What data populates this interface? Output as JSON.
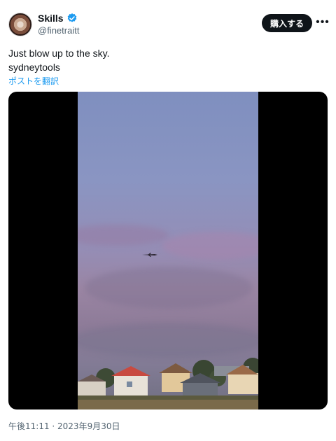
{
  "author": {
    "display_name": "Skills",
    "handle": "@finetraitt"
  },
  "header": {
    "subscribe_label": "購入する",
    "more_label": "•••"
  },
  "tweet": {
    "text_lines": [
      "Just blow up to the sky.",
      "sydneytools"
    ],
    "translate_label": "ポストを翻訳"
  },
  "timestamp": "午後11:11 · 2023年9月30日",
  "colors": {
    "accent": "#1d9bf0",
    "text_primary": "#0f1419",
    "text_secondary": "#536471",
    "button_bg": "#0f1419"
  },
  "icons": [
    "verified-badge-icon",
    "more-options-icon",
    "airplane-icon"
  ]
}
